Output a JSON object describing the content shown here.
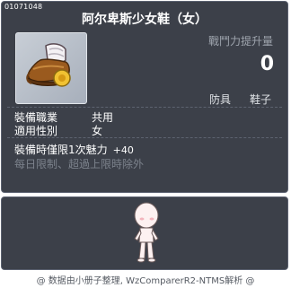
{
  "item": {
    "id": "01071048",
    "name": "阿尔卑斯少女鞋（女）",
    "icon": "shoe-icon"
  },
  "stats": {
    "power_label": "戰鬥力提升量",
    "power_value": "0"
  },
  "tags": [
    "防具",
    "鞋子"
  ],
  "attributes": [
    {
      "label": "裝備職業",
      "value": "共用"
    },
    {
      "label": "適用性別",
      "value": "女"
    }
  ],
  "effect": {
    "text": "裝備時僅限1次魅力",
    "bonus": "+40"
  },
  "note": "每日限制、超過上限時除外",
  "preview": {
    "character_icon": "character-preview"
  },
  "footer": "@ 数据由小册子整理, WzComparerR2-NTMS解析 @",
  "colors": {
    "panel": "#3c4049",
    "border": "#5b6170",
    "muted_text": "#9ea4ad",
    "note_text": "#7c828c"
  }
}
